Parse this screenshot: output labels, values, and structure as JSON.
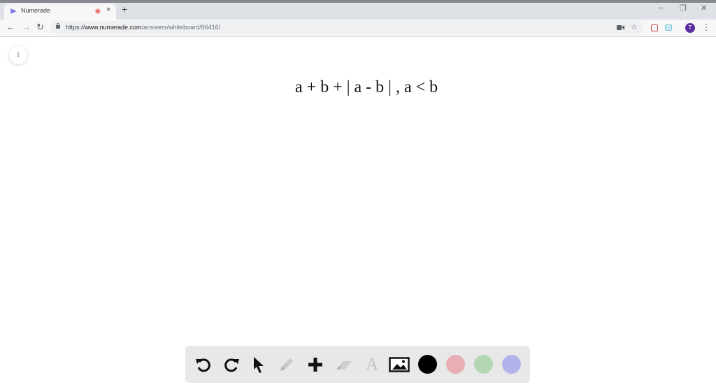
{
  "browser": {
    "tab": {
      "title": "Numerade",
      "close_glyph": "×"
    },
    "new_tab_glyph": "+",
    "window_controls": {
      "minimize": "−",
      "restore": "❐",
      "close": "✕"
    },
    "nav": {
      "back": "←",
      "forward": "→",
      "reload": "↻"
    },
    "address": {
      "scheme": "https://",
      "host": "www.numerade.com",
      "path": "/answers/whiteboard/96416/"
    },
    "profile_initial": "T",
    "bookmark_glyph": "☆",
    "menu_glyph": "⋮"
  },
  "whiteboard": {
    "page_number": "1",
    "expression": "a + b + | a - b | , a < b"
  },
  "toolbar": {
    "tools": [
      {
        "name": "undo-icon"
      },
      {
        "name": "redo-icon"
      },
      {
        "name": "select-arrow-icon"
      },
      {
        "name": "pencil-icon",
        "enabled": false
      },
      {
        "name": "add-icon"
      },
      {
        "name": "eraser-icon",
        "enabled": false
      },
      {
        "name": "text-icon",
        "enabled": false
      },
      {
        "name": "image-icon"
      }
    ],
    "text_tool_glyph": "A",
    "colors": [
      "#000000",
      "#e8aeb3",
      "#b3d6b5",
      "#b2b3ea"
    ]
  }
}
